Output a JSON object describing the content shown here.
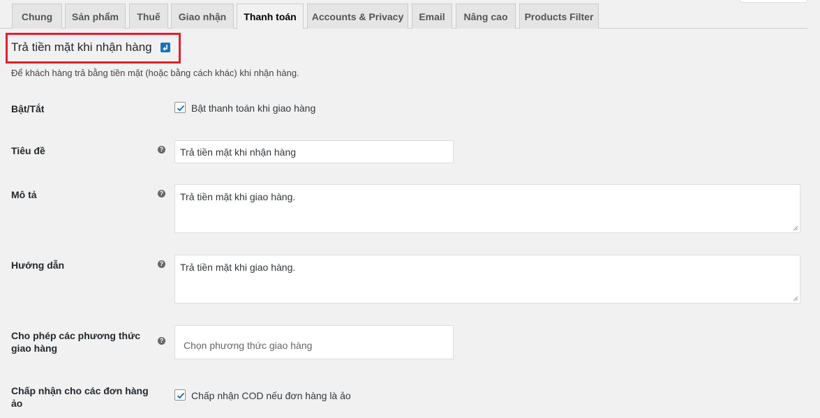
{
  "tabs": [
    {
      "label": "Chung",
      "active": false
    },
    {
      "label": "Sản phẩm",
      "active": false
    },
    {
      "label": "Thuế",
      "active": false
    },
    {
      "label": "Giao nhận",
      "active": false
    },
    {
      "label": "Thanh toán",
      "active": true
    },
    {
      "label": "Accounts & Privacy",
      "active": false
    },
    {
      "label": "Email",
      "active": false
    },
    {
      "label": "Nâng cao",
      "active": false
    },
    {
      "label": "Products Filter",
      "active": false
    }
  ],
  "section": {
    "title": "Trả tiền mặt khi nhận hàng",
    "return_icon": "return-arrow-icon",
    "description": "Để khách hàng trả bằng tiền mặt (hoặc bằng cách khác) khi nhận hàng."
  },
  "fields": {
    "enable": {
      "label": "Bật/Tắt",
      "checkbox_label": "Bật thanh toán khi giao hàng",
      "checked": true
    },
    "title": {
      "label": "Tiêu đề",
      "value": "Trả tiền mặt khi nhận hàng"
    },
    "description": {
      "label": "Mô tả",
      "value": "Trả tiền mặt khi giao hàng."
    },
    "instructions": {
      "label": "Hướng dẫn",
      "value": "Trả tiền mặt khi giao hàng."
    },
    "shipping_methods": {
      "label": "Cho phép các phương thức giao hàng",
      "placeholder": "Chọn phương thức giao hàng"
    },
    "virtual_orders": {
      "label": "Chấp nhận cho các đơn hàng ảo",
      "checkbox_label": "Chấp nhận COD nếu đơn hàng là ảo",
      "checked": true
    }
  },
  "colors": {
    "accent": "#2271b1",
    "highlight_border": "#e0202b",
    "background": "#f1f1f1"
  }
}
